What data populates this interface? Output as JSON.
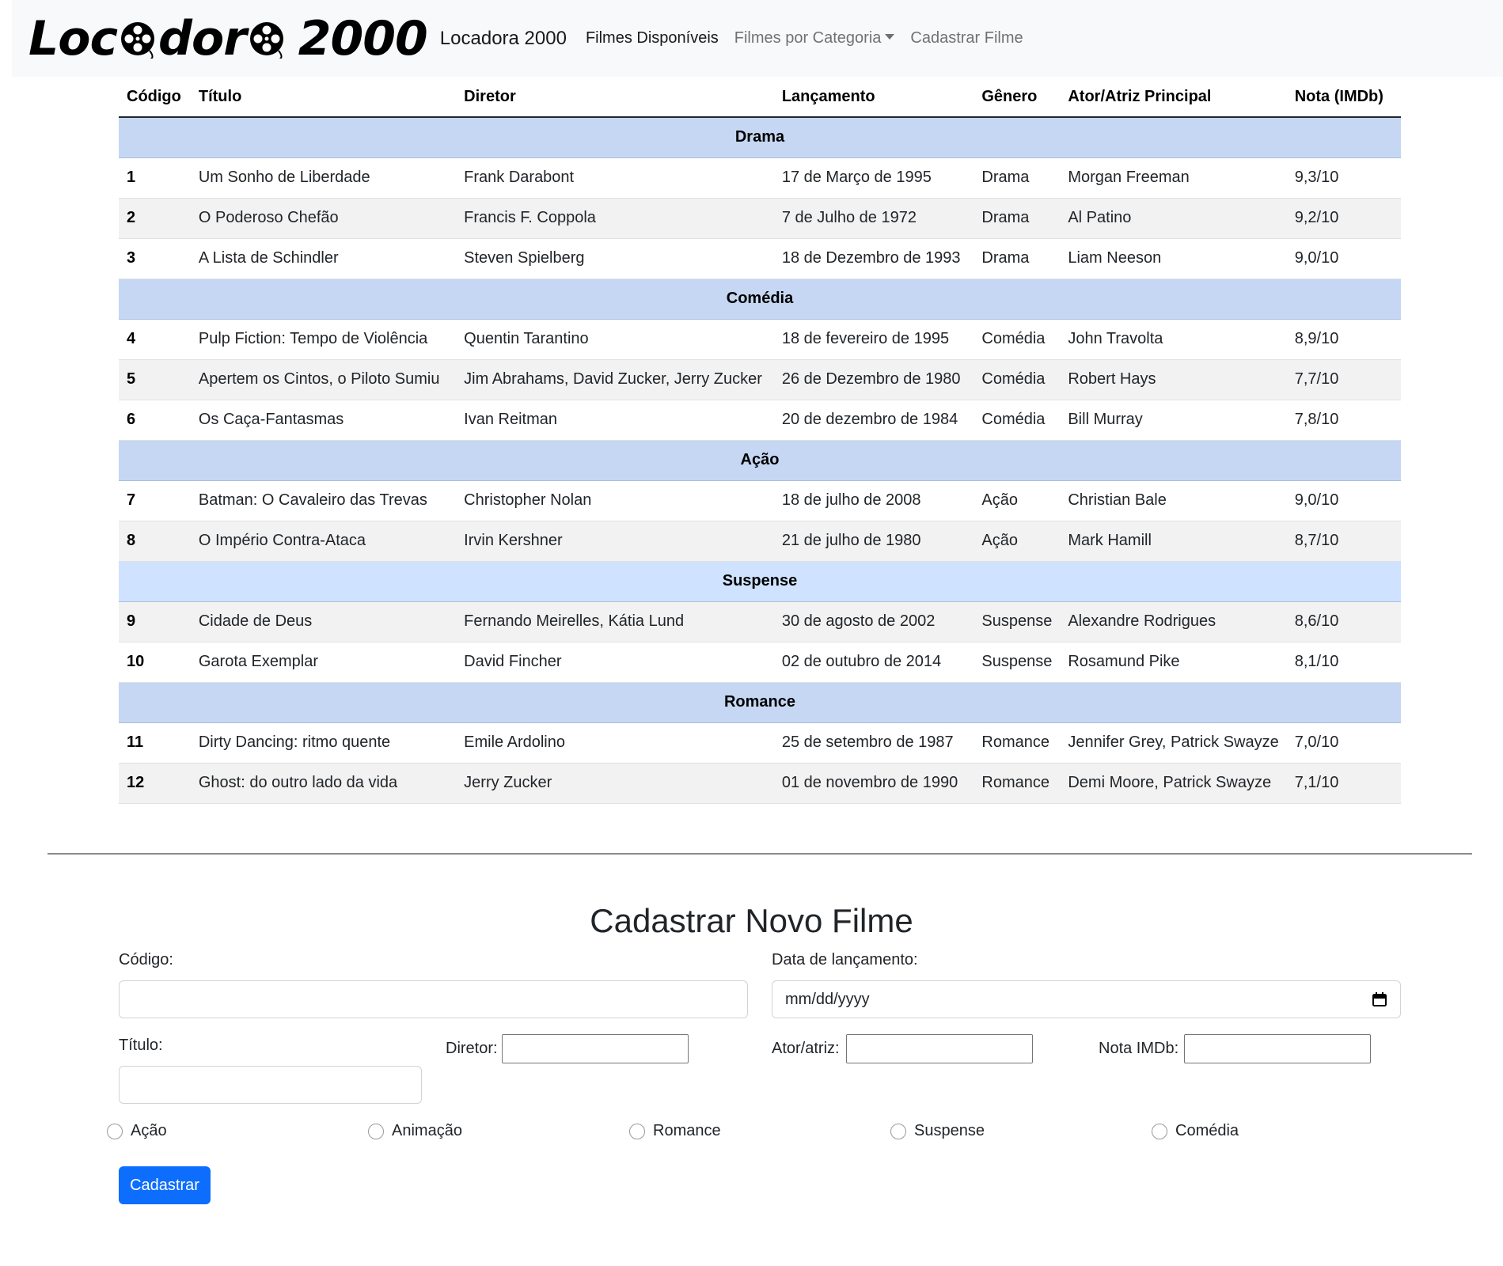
{
  "navbar": {
    "logo": {
      "part1": "Loc",
      "part2": "dor",
      "part3": "2000"
    },
    "brand": "Locadora 2000",
    "links": [
      {
        "label": "Filmes Disponíveis",
        "active": true
      },
      {
        "label": "Filmes por Categoria",
        "dropdown": true
      },
      {
        "label": "Cadastrar Filme"
      }
    ]
  },
  "table": {
    "headers": [
      "Código",
      "Título",
      "Diretor",
      "Lançamento",
      "Gênero",
      "Ator/Atriz Principal",
      "Nota (IMDb)"
    ],
    "groups": [
      {
        "category": "Drama",
        "rows": [
          [
            "1",
            "Um Sonho de Liberdade",
            "Frank Darabont",
            "17 de Março de 1995",
            "Drama",
            "Morgan Freeman",
            "9,3/10"
          ],
          [
            "2",
            "O Poderoso Chefão",
            "Francis F. Coppola",
            "7 de Julho de 1972",
            "Drama",
            "Al Patino",
            "9,2/10"
          ],
          [
            "3",
            "A Lista de Schindler",
            "Steven Spielberg",
            "18 de Dezembro de 1993",
            "Drama",
            "Liam Neeson",
            "9,0/10"
          ]
        ]
      },
      {
        "category": "Comédia",
        "rows": [
          [
            "4",
            "Pulp Fiction: Tempo de Violência",
            "Quentin Tarantino",
            "18 de fevereiro de 1995",
            "Comédia",
            "John Travolta",
            "8,9/10"
          ],
          [
            "5",
            "Apertem os Cintos, o Piloto Sumiu",
            "Jim Abrahams, David Zucker, Jerry Zucker",
            "26 de Dezembro de 1980",
            "Comédia",
            "Robert Hays",
            "7,7/10"
          ],
          [
            "6",
            "Os Caça-Fantasmas",
            "Ivan Reitman",
            "20 de dezembro de 1984",
            "Comédia",
            "Bill Murray",
            "7,8/10"
          ]
        ]
      },
      {
        "category": "Ação",
        "rows": [
          [
            "7",
            "Batman: O Cavaleiro das Trevas",
            "Christopher Nolan",
            "18 de julho de 2008",
            "Ação",
            "Christian Bale",
            "9,0/10"
          ],
          [
            "8",
            "O Império Contra-Ataca",
            "Irvin Kershner",
            "21 de julho de 1980",
            "Ação",
            "Mark Hamill",
            "8,7/10"
          ]
        ]
      },
      {
        "category": "Suspense",
        "rows": [
          [
            "9",
            "Cidade de Deus",
            "Fernando Meirelles, Kátia Lund",
            "30 de agosto de 2002",
            "Suspense",
            "Alexandre Rodrigues",
            "8,6/10"
          ],
          [
            "10",
            "Garota Exemplar",
            "David Fincher",
            "02 de outubro de 2014",
            "Suspense",
            "Rosamund Pike",
            "8,1/10"
          ]
        ]
      },
      {
        "category": "Romance",
        "rows": [
          [
            "11",
            "Dirty Dancing: ritmo quente",
            "Emile Ardolino",
            "25 de setembro de 1987",
            "Romance",
            "Jennifer Grey, Patrick Swayze",
            "7,0/10"
          ],
          [
            "12",
            "Ghost: do outro lado da vida",
            "Jerry Zucker",
            "01 de novembro de 1990",
            "Romance",
            "Demi Moore, Patrick Swayze",
            "7,1/10"
          ]
        ]
      }
    ]
  },
  "form": {
    "title": "Cadastrar Novo Filme",
    "codigo_label": "Código:",
    "data_label": "Data de lançamento:",
    "data_placeholder": "mm/dd/yyyy",
    "titulo_label": "Título:",
    "diretor_label": "Diretor:",
    "ator_label": "Ator/atriz:",
    "nota_label": "Nota IMDb:",
    "genres": [
      "Ação",
      "Animação",
      "Romance",
      "Suspense",
      "Comédia"
    ],
    "submit_label": "Cadastrar"
  },
  "colors": {
    "navbar_bg": "#f8f9fa",
    "category_row": "#c5d7f2",
    "stripe": "#f2f2f2",
    "primary_button": "#0d6efd"
  }
}
